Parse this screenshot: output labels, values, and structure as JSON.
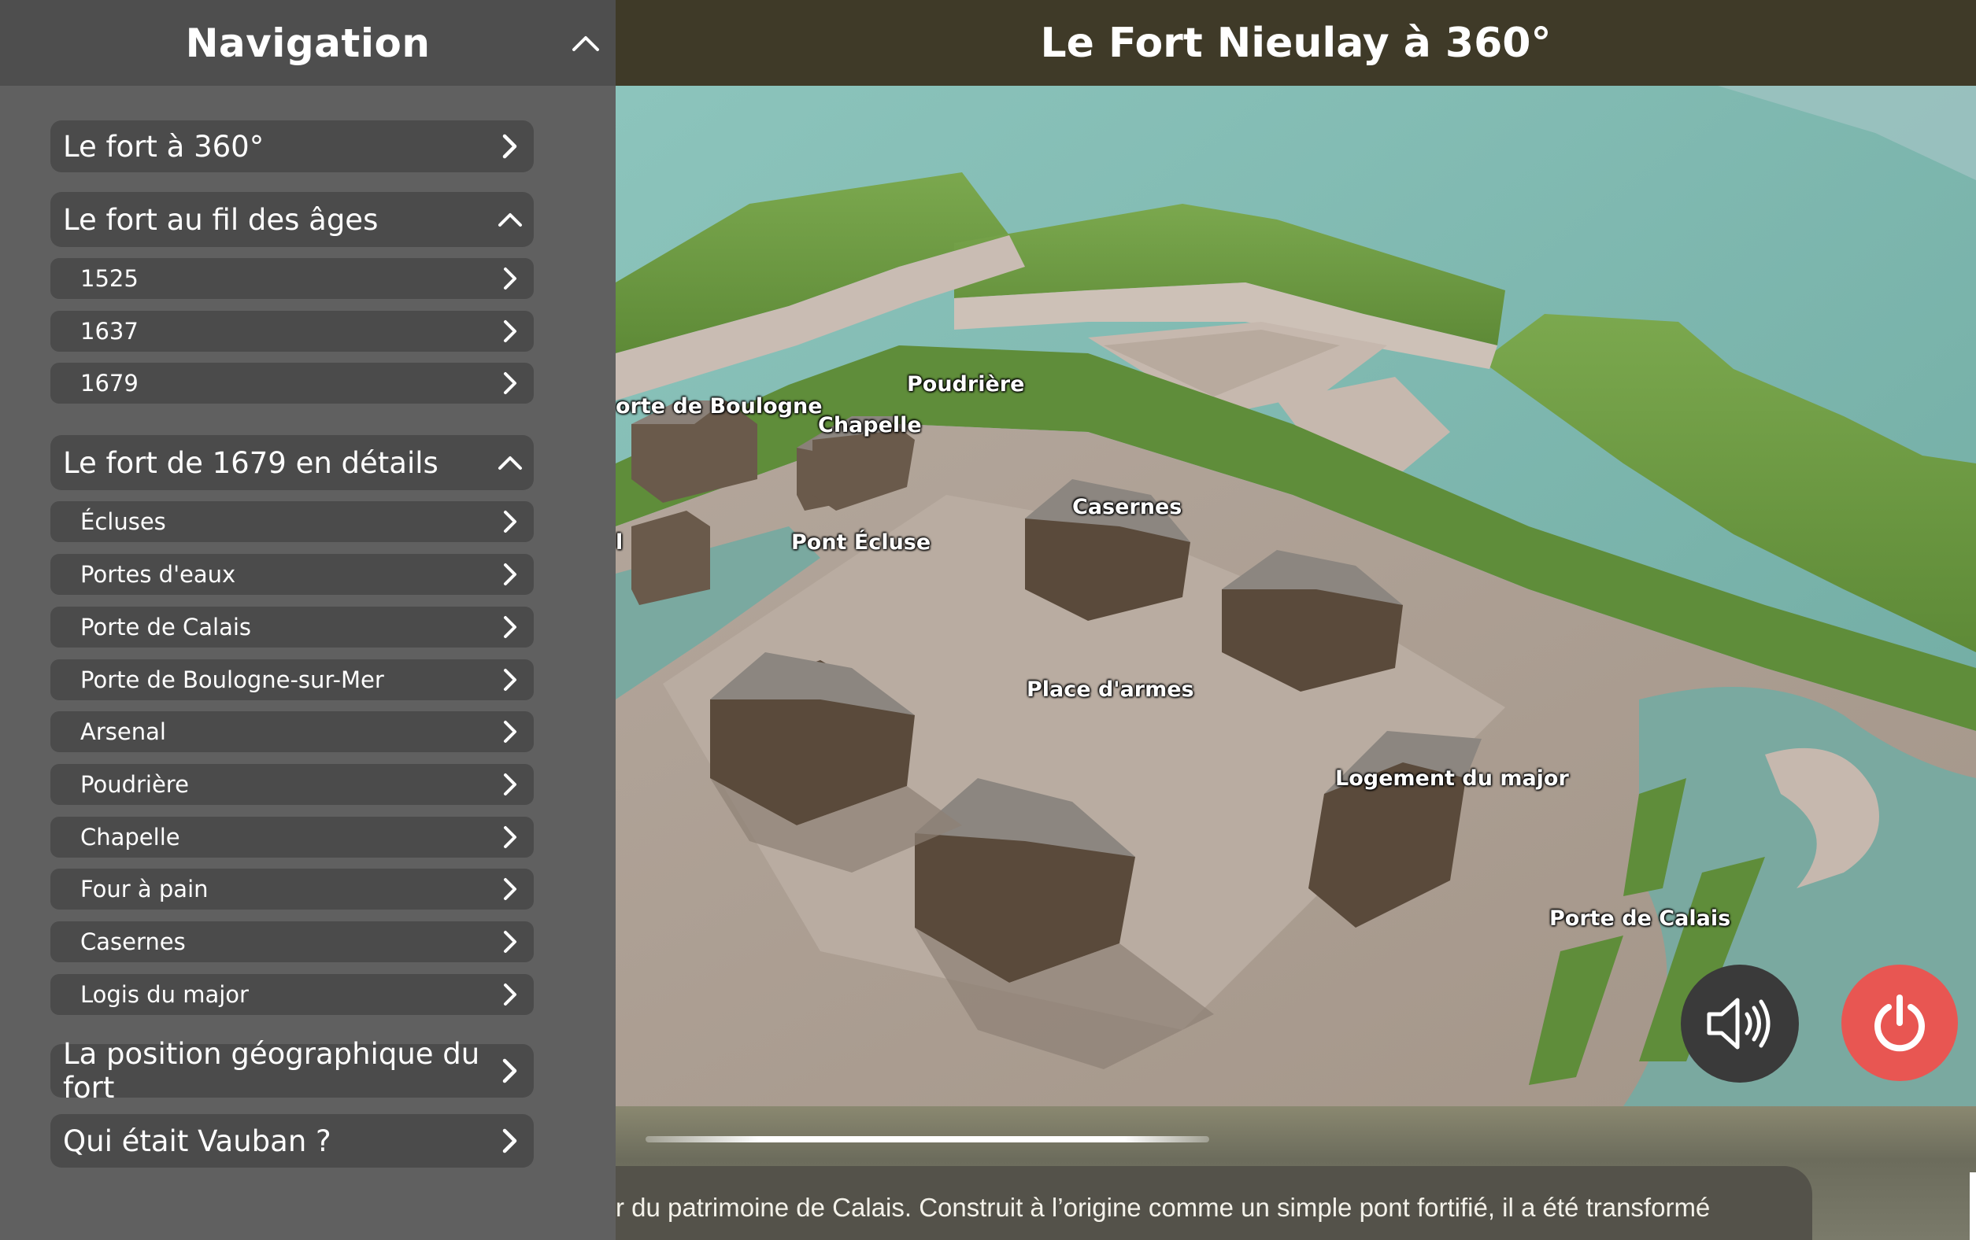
{
  "sidebar": {
    "title": "Navigation",
    "items": [
      {
        "label": "Le fort à 360°"
      },
      {
        "label": "Le fort au fil des âges"
      },
      {
        "label": "1525"
      },
      {
        "label": "1637"
      },
      {
        "label": "1679"
      },
      {
        "label": "Le fort de 1679 en détails"
      },
      {
        "label": "Écluses"
      },
      {
        "label": "Portes d'eaux"
      },
      {
        "label": "Porte de Calais"
      },
      {
        "label": "Porte de Boulogne-sur-Mer"
      },
      {
        "label": "Arsenal"
      },
      {
        "label": "Poudrière"
      },
      {
        "label": "Chapelle"
      },
      {
        "label": "Four à pain"
      },
      {
        "label": "Casernes"
      },
      {
        "label": "Logis du major"
      },
      {
        "label": "La position géographique du fort"
      },
      {
        "label": "Qui était Vauban ?"
      }
    ]
  },
  "header": {
    "title": "Le Fort Nieulay à 360°"
  },
  "scene": {
    "labels": {
      "porte_boulogne": "orte de Boulogne",
      "poudriere": "Poudrière",
      "chapelle": "Chapelle",
      "casernes": "Casernes",
      "pont_ecluse": "Pont Écluse",
      "cut_left": "l",
      "place_armes": "Place d'armes",
      "logement_major": "Logement du major",
      "porte_calais": "Porte de Calais"
    }
  },
  "controls": {
    "sound_icon": "speaker-icon",
    "power_icon": "power-icon",
    "power_color": "#e85652",
    "progress": 0.35
  },
  "caption": {
    "line1": "r du patrimoine de Calais. Construit à l’origine comme un simple pont fortifié, il a été transformé"
  },
  "colors": {
    "sidebar_bg": "#606060",
    "sidebar_header_bg": "#4e4e4e",
    "item_bg": "#4b4b4b",
    "topbar_bg": "#3f3a28"
  }
}
